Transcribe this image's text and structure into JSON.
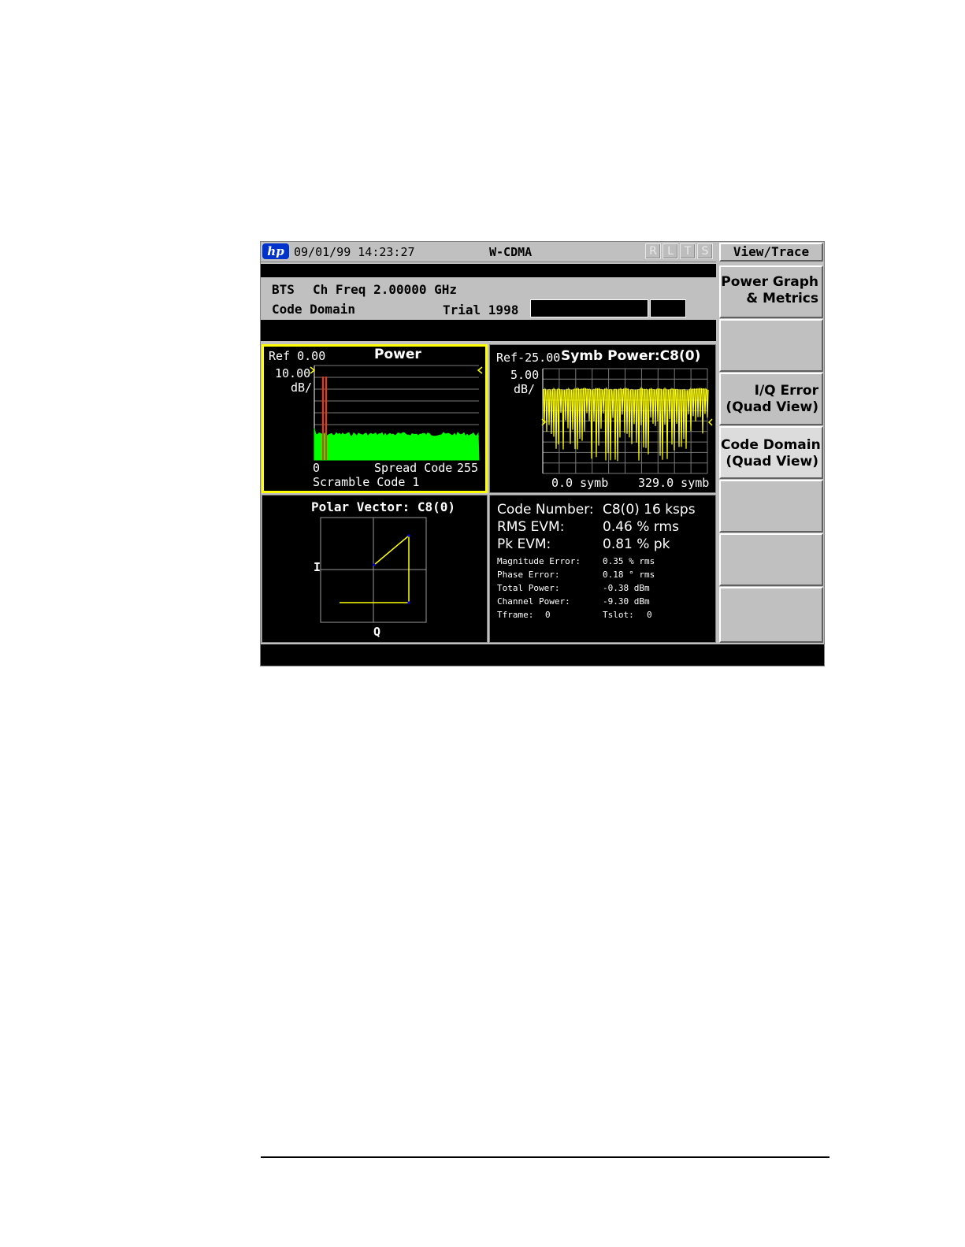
{
  "window": {
    "datetime": "09/01/99 14:23:27",
    "mode": "W-CDMA",
    "logo": "hp",
    "indicators": [
      "R",
      "L",
      "T",
      "S"
    ]
  },
  "header": {
    "device": "BTS",
    "ch_freq": "Ch Freq 2.00000 GHz",
    "measurement": "Code Domain",
    "trial": "Trial 1998"
  },
  "power_panel": {
    "ref": "Ref 0.00",
    "title": "Power",
    "scale_value": "10.00",
    "scale_unit": "dB/",
    "x_start": "0",
    "x_label": "Spread Code",
    "x_end": "255",
    "scramble": "Scramble Code 1",
    "colors": {
      "trace": "#00ff00",
      "marker": "#ff3300",
      "frame": "#ffff00"
    }
  },
  "symb_panel": {
    "ref": "Ref-25.00",
    "title": "Symb Power:C8(0)",
    "scale_value": "5.00",
    "scale_unit": "dB/",
    "x_start": "0.0 symb",
    "x_end": "329.0 symb",
    "colors": {
      "trace": "#ffff00"
    }
  },
  "polar_panel": {
    "title": "Polar Vector: C8(0)",
    "i_label": "I",
    "q_label": "Q",
    "colors": {
      "trace": "#ffff00",
      "points": "#0000ff"
    }
  },
  "metrics": {
    "large": [
      {
        "label": "Code Number:",
        "value": "C8(0) 16 ksps"
      },
      {
        "label": "RMS EVM:",
        "value": "0.46 % rms"
      },
      {
        "label": "Pk EVM:",
        "value": "0.81 % pk"
      }
    ],
    "small": [
      {
        "label": "Magnitude Error:",
        "value": "0.35 % rms"
      },
      {
        "label": "Phase Error:",
        "value": "0.18 ° rms"
      },
      {
        "label": "Total Power:",
        "value": "-0.38 dBm"
      },
      {
        "label": "Channel Power:",
        "value": "-9.30 dBm"
      }
    ],
    "tframe_label": "Tframe:",
    "tframe_value": "0",
    "tslot_label": "Tslot:",
    "tslot_value": "0"
  },
  "softkeys": {
    "menu_title": "View/Trace",
    "keys": [
      {
        "line1": "Power Graph",
        "line2": "& Metrics"
      },
      {
        "line1": "",
        "line2": ""
      },
      {
        "line1": "I/Q Error",
        "line2": "(Quad View)"
      },
      {
        "line1": "Code Domain",
        "line2": "(Quad View)"
      },
      {
        "line1": "",
        "line2": ""
      },
      {
        "line1": "",
        "line2": ""
      },
      {
        "line1": "",
        "line2": ""
      }
    ]
  }
}
